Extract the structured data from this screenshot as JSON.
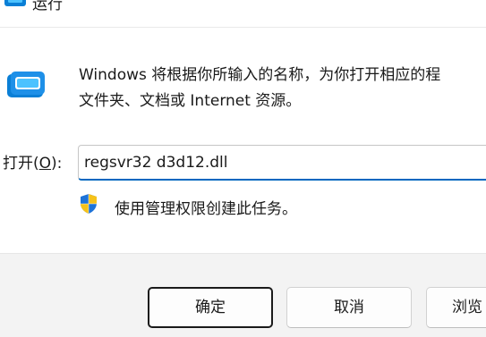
{
  "window": {
    "title": "运行"
  },
  "main": {
    "description_line1": "Windows 将根据你所输入的名称，为你打开相应的程",
    "description_line2": "文件夹、文档或 Internet 资源。",
    "open_label_prefix": "打开(",
    "open_label_accel": "O",
    "open_label_suffix": "):",
    "open_value": "regsvr32 d3d12.dll",
    "admin_note": "使用管理权限创建此任务。"
  },
  "footer": {
    "ok_label": "确定",
    "cancel_label": "取消",
    "browse_label": "浏览"
  },
  "icons": {
    "title_icon": "run-icon",
    "app_icon": "run-icon",
    "shield_icon": "uac-shield-icon"
  },
  "colors": {
    "accent": "#0067c0",
    "footer_bg": "#f3f3f3",
    "run_icon_blue": "#0a7fd6",
    "run_icon_cyan": "#4cc2ff",
    "shield_blue": "#1e73d8",
    "shield_yellow": "#f6c21a"
  }
}
